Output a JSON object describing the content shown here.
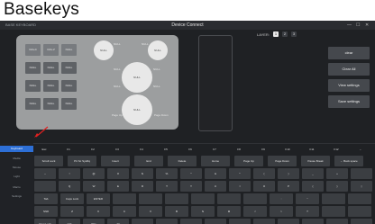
{
  "heading": "Basekeys",
  "window": {
    "app_title": "BASE KEYBOARD",
    "title": "Device Connect",
    "buttons": [
      "—",
      "☐",
      "✕"
    ]
  },
  "layer": {
    "label": "LAYER:",
    "buttons": [
      "1",
      "2",
      "3"
    ],
    "active_index": 0
  },
  "device": {
    "keys": [
      [
        "Ctrl+C",
        "Ctrl+V",
        "NULL"
      ],
      [
        "NULL",
        "NULL",
        "NULL"
      ],
      [
        "NULL",
        "NULL",
        "NULL"
      ],
      [
        "NULL",
        "NULL",
        "NULL"
      ]
    ],
    "knob_top_left": "NULL",
    "knob_top_right": "NULL",
    "knob_center": "NULL",
    "knob_bottom_big": "NULL",
    "knob_small_labels": [
      "NULL",
      "NULL",
      "NULL",
      "NULL",
      "NULL",
      "NULL"
    ],
    "knob_page_labels": [
      "Page Up",
      "Page Down"
    ]
  },
  "side_buttons": [
    "clear",
    "Clear All",
    "View settings",
    "Save settings"
  ],
  "nav": {
    "items": [
      "Keyboard",
      "Media",
      "Mouse",
      "Light",
      "Macro",
      "Settings"
    ],
    "active_index": 0
  },
  "keyboard": {
    "fn_row": [
      "Esc",
      "F1",
      "F2",
      "F3",
      "F4",
      "F5",
      "F6",
      "F7",
      "F8",
      "F9",
      "F10",
      "F11",
      "F12",
      "←"
    ],
    "row1": [
      "Scroll Lock",
      "Prt Sc SysRq",
      "Insert",
      "End",
      "Delete",
      "Home",
      "Page Up",
      "Page Down",
      "Pause Break",
      "← Back space"
    ],
    "row2": [
      "~",
      "!",
      "@",
      "#",
      "$",
      "%",
      "^",
      "&",
      "*",
      "(",
      ")",
      "_",
      "+",
      ""
    ],
    "row3": [
      "",
      "Q",
      "W",
      "E",
      "R",
      "T",
      "Y",
      "U",
      "I",
      "O",
      "P",
      "{",
      "}",
      "|"
    ],
    "row4": [
      "Tab",
      "Caps Lock",
      "ENTER",
      "",
      "",
      "",
      "",
      "",
      "",
      ":",
      "\"",
      "",
      ""
    ],
    "row5": [
      "Shift",
      "Z",
      "X",
      "C",
      "V",
      "B",
      "N",
      "M",
      "<",
      ">",
      "?",
      "",
      ""
    ],
    "row6": [
      "Num Lock",
      "Ctrl",
      "Win",
      "Alt",
      "",
      "",
      "",
      "",
      "",
      "",
      "",
      "",
      "",
      ""
    ]
  }
}
